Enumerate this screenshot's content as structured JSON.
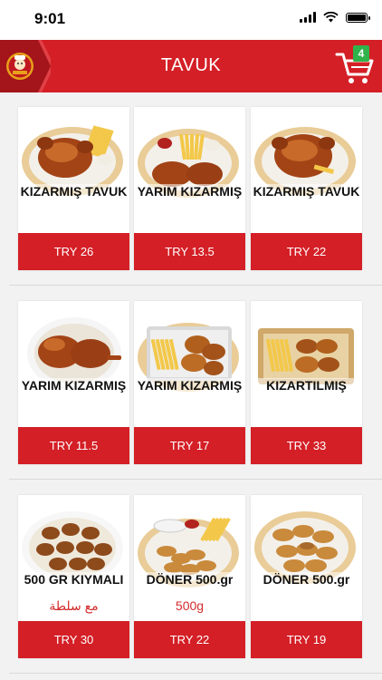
{
  "status": {
    "time": "9:01"
  },
  "header": {
    "title": "TAVUK",
    "cart_count": "4"
  },
  "colors": {
    "brand_red": "#d41f26",
    "badge_green": "#2fb34a",
    "subtitle_red": "#d42a2a"
  },
  "products": [
    {
      "name": "KIZARMIŞ TAVUK",
      "sub": "",
      "price": "TRY 26",
      "image": "whole-chicken-fries"
    },
    {
      "name": "YARIM KIZARMIŞ",
      "sub": "",
      "price": "TRY 13.5",
      "image": "half-chicken-fries"
    },
    {
      "name": "KIZARMIŞ TAVUK",
      "sub": "",
      "price": "TRY 22",
      "image": "whole-chicken"
    },
    {
      "name": "YARIM KIZARMIŞ",
      "sub": "",
      "price": "TRY 11.5",
      "image": "half-chicken"
    },
    {
      "name": "YARIM KIZARMIŞ",
      "sub": "",
      "price": "TRY 17",
      "image": "fried-pieces-fries"
    },
    {
      "name": "KIZARTILMIŞ",
      "sub": "",
      "price": "TRY 33",
      "image": "fried-tray"
    },
    {
      "name": "500 GR KIYMALI",
      "sub": "مع سلطة",
      "price": "TRY 30",
      "image": "kibbeh-plate"
    },
    {
      "name": "DÖNER 500.gr",
      "sub": "500g",
      "price": "TRY 22",
      "image": "doner-fries"
    },
    {
      "name": "DÖNER 500.gr",
      "sub": "",
      "price": "TRY 19",
      "image": "doner-plate"
    }
  ]
}
